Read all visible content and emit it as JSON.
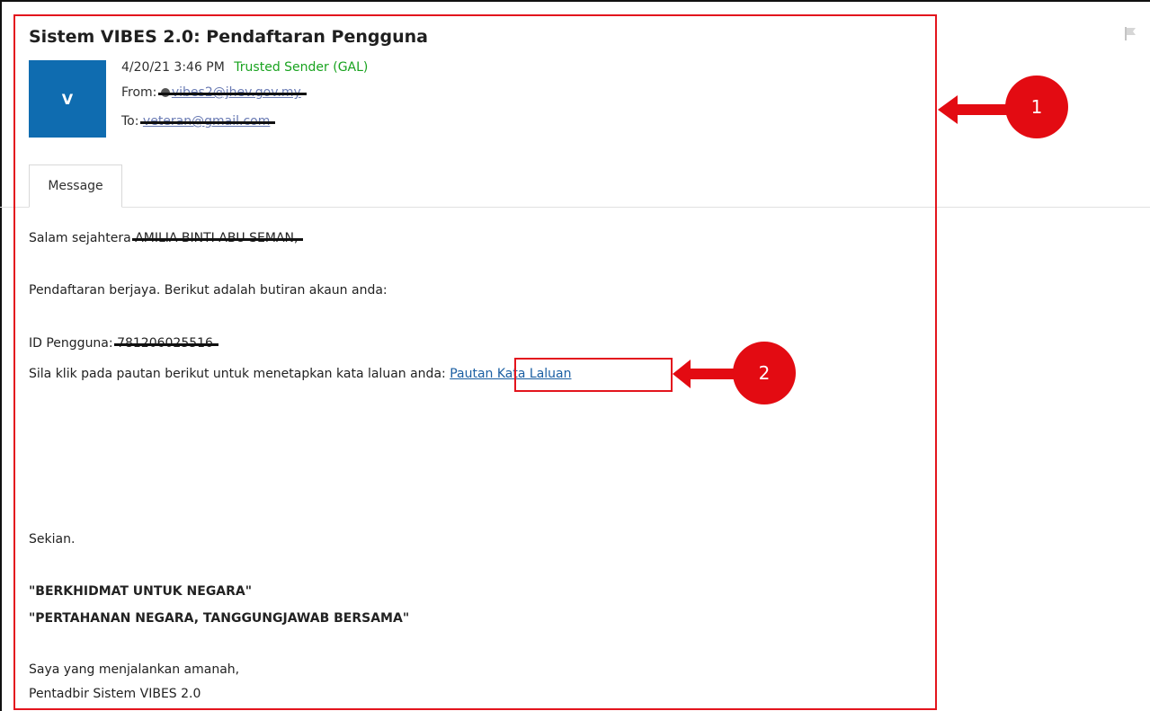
{
  "email": {
    "subject": "Sistem VIBES 2.0: Pendaftaran Pengguna",
    "avatar_initial": "V",
    "datetime": "4/20/21 3:46 PM",
    "trusted_label": "Trusted Sender (GAL)",
    "from_label": "From:",
    "from_address": "vibes2@jhev.gov.my",
    "to_label": "To:",
    "to_address": "veteran@gmail.com",
    "tab_label": "Message"
  },
  "message": {
    "greeting": "Salam sejahtera",
    "greeting_name": "AMILIA BINTI ABU SEMAN,",
    "line_success": "Pendaftaran berjaya. Berikut adalah butiran akaun anda:",
    "user_id_label": "ID Pengguna:",
    "user_id_value": "781206025516",
    "set_password_text": "Sila klik pada pautan berikut untuk menetapkan kata laluan anda:",
    "link_label": "Pautan Kata Laluan",
    "closing": "Sekian.",
    "slogan_1": "\"BERKHIDMAT UNTUK NEGARA\"",
    "slogan_2": "\"PERTAHANAN NEGARA, TANGGUNGJAWAB BERSAMA\"",
    "sign_line_1": "Saya yang menjalankan amanah,",
    "sign_line_2": "Pentadbir Sistem VIBES 2.0"
  },
  "callouts": {
    "one": "1",
    "two": "2"
  },
  "colors": {
    "avatar": "#0f6cb0",
    "trusted": "#19a31f",
    "link": "#1b5fa3",
    "annotation": "#e30b12"
  }
}
